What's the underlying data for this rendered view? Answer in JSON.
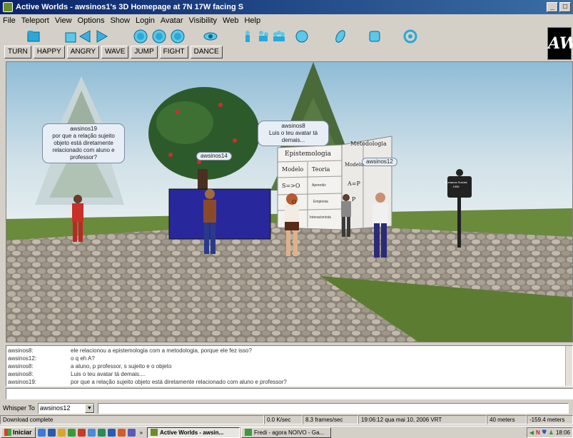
{
  "window": {
    "title": "Active Worlds - awsinos1's 3D Homepage at 7N 17W facing S",
    "minimize": "_",
    "maximize": "□"
  },
  "menu": [
    "File",
    "Teleport",
    "View",
    "Options",
    "Show",
    "Login",
    "Avatar",
    "Visibility",
    "Web",
    "Help"
  ],
  "logo": "AW",
  "gestures": [
    "TURN",
    "HAPPY",
    "ANGRY",
    "WAVE",
    "JUMP",
    "FIGHT",
    "DANCE"
  ],
  "world": {
    "bubble_left": "awsinos19\npor que a relação sujeito\nobjeto está diretamente\nrelacionado com aluno e\nprofessor?",
    "bubble_left_name": "awsinos19",
    "bubble_left_text": "por que a relação sujeito objeto está diretamente relacionado com aluno e professor?",
    "tag_center": "awsinos14",
    "bubble_center_name": "awsinos8",
    "bubble_center_text": "Luis o teu avatar tá demais...",
    "tag_right": "awsinos12",
    "board": {
      "header_left": "Epistemologia",
      "header_right": "Metodologia",
      "cell_modelo": "Modelo",
      "cell_teoria": "Teoria",
      "cell_modelo2": "Modelo",
      "cell_s_o": "S=>O",
      "cell_o": "O",
      "cell_a_p": "A=P",
      "cell_p": "P",
      "cell_aprendiz": "Aprendiz",
      "cell_empirista": "Empirista",
      "cell_interacionista": "Interacionista"
    },
    "sign": "Humanos Sociais 1996"
  },
  "chat": [
    {
      "who": "awsinos8:",
      "msg": "ele relacionou a epistemologia com a metodologia, porque ele fez isso?"
    },
    {
      "who": "awsinos12:",
      "msg": "o q eh A?"
    },
    {
      "who": "awsinos8:",
      "msg": "a aluno, p professor, s sujeito e o objeto"
    },
    {
      "who": "awsinos8:",
      "msg": "Luis o teu avatar tá demais...."
    },
    {
      "who": "awsinos19:",
      "msg": "por que a relação sujeito objeto está diretamente relacionado com aluno e professor?"
    }
  ],
  "whisper": {
    "label": "Whisper To",
    "value": "awsinos12"
  },
  "status": {
    "main": "Download complete",
    "speed": "0.0 K/sec",
    "fps": "8.3 frames/sec",
    "datetime": "19:06:12 qua mai 10, 2006 VRT",
    "distance": "40 meters",
    "altitude": "-159.4 meters"
  },
  "taskbar": {
    "start": "Iniciar",
    "tasks": [
      "Active Worlds - awsin...",
      "Fredi - agora NOIVO - Ga..."
    ],
    "clock": "18:06"
  }
}
